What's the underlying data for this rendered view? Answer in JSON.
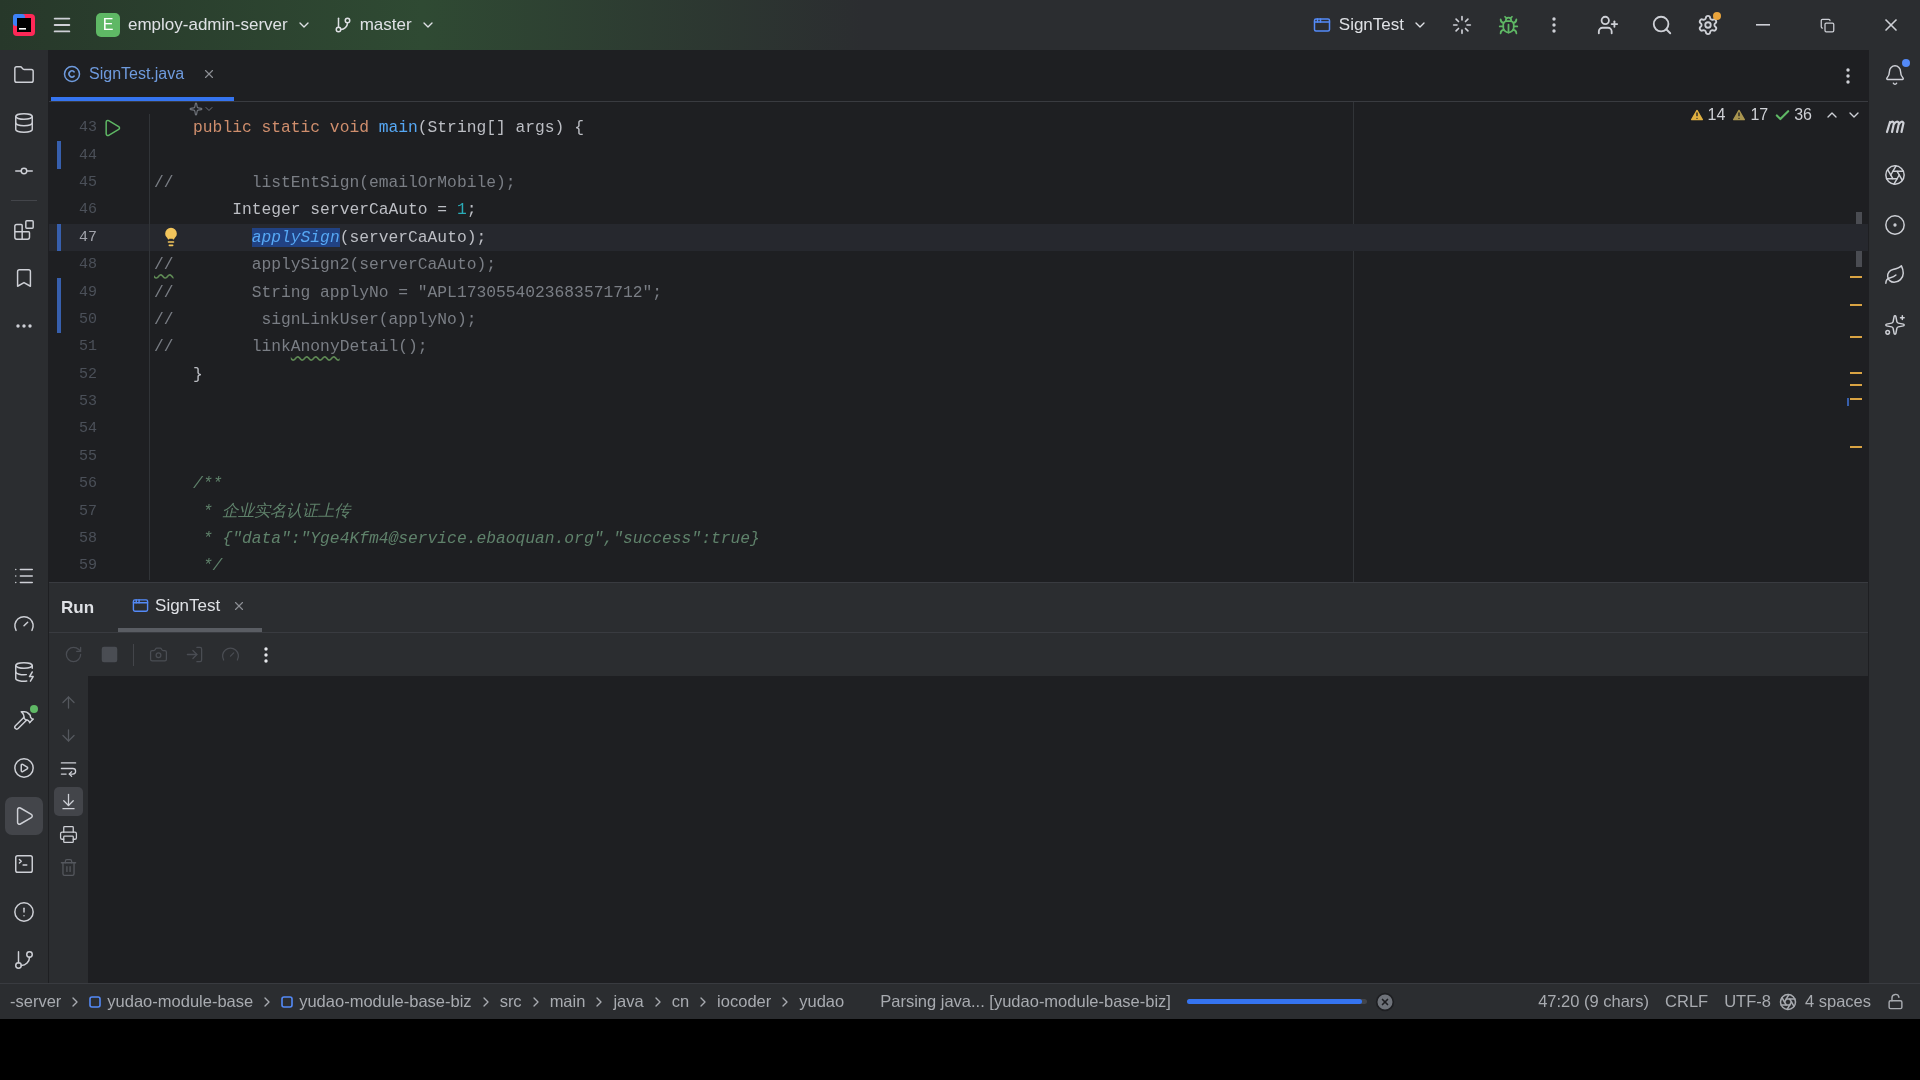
{
  "title_bar": {
    "project_badge": "E",
    "project": "employ-admin-server",
    "branch": "master",
    "run_config": "SignTest"
  },
  "left_tools_top": [
    {
      "kind": "project",
      "selected": false
    },
    {
      "kind": "database",
      "selected": false
    },
    {
      "kind": "commit",
      "selected": false
    },
    {
      "kind": "structure",
      "selected": false
    },
    {
      "kind": "bookmarks",
      "selected": false
    },
    {
      "kind": "more",
      "selected": false
    }
  ],
  "left_tools_bottom": [
    {
      "kind": "outline",
      "selected": false
    },
    {
      "kind": "profiler",
      "selected": false
    },
    {
      "kind": "db-check",
      "selected": false
    },
    {
      "kind": "build",
      "selected": false
    },
    {
      "kind": "services",
      "selected": false
    },
    {
      "kind": "run",
      "selected": true
    },
    {
      "kind": "terminal",
      "selected": false
    },
    {
      "kind": "problems",
      "selected": false
    },
    {
      "kind": "git",
      "selected": false
    }
  ],
  "right_tools": [
    {
      "kind": "notifications"
    },
    {
      "kind": "script"
    },
    {
      "kind": "aperture"
    },
    {
      "kind": "target"
    },
    {
      "kind": "leaf"
    },
    {
      "kind": "assistant"
    }
  ],
  "editor": {
    "tabs": [
      {
        "label": "SignTest.java",
        "selected": true
      }
    ],
    "inspections": [
      {
        "kind": "warning",
        "count": "14"
      },
      {
        "kind": "weak-warning",
        "count": "17"
      },
      {
        "kind": "ok",
        "count": "36"
      }
    ],
    "lines": [
      {
        "number": "43",
        "gutter": {
          "kind": "run"
        },
        "changed": false,
        "current": false,
        "tokens": [
          {
            "text": "    public static void ",
            "kind": "keyword"
          },
          {
            "text": "main",
            "kind": "method"
          },
          {
            "text": "(String[] args) {",
            "kind": "plain"
          }
        ]
      },
      {
        "number": "44",
        "changed": true,
        "current": false
      },
      {
        "number": "45",
        "changed": false,
        "current": false,
        "tokens": [
          {
            "text": "//        listEntSign(emailOrMobile);",
            "kind": "comment"
          }
        ]
      },
      {
        "number": "46",
        "changed": false,
        "current": false,
        "tokens": [
          {
            "text": "        Integer serverCaAuto = ",
            "kind": "plain"
          },
          {
            "text": "1",
            "kind": "number"
          },
          {
            "text": ";",
            "kind": "plain"
          }
        ]
      },
      {
        "number": "47",
        "gutter": {
          "kind": "bulb"
        },
        "changed": true,
        "current": true,
        "tokens": [
          {
            "text": "          applySign",
            "kind": "selected-method"
          },
          {
            "text": "(serverCaAuto);",
            "kind": "plain"
          }
        ]
      },
      {
        "number": "48",
        "changed": false,
        "current": false,
        "tokens": [
          {
            "text": "//",
            "kind": "comment-typo"
          },
          {
            "text": "        applySign2(serverCaAuto);",
            "kind": "comment"
          }
        ]
      },
      {
        "number": "49",
        "changed": true,
        "current": false,
        "tokens": [
          {
            "text": "//        String applyNo = \"APL1730554023683571712\";",
            "kind": "comment"
          }
        ]
      },
      {
        "number": "50",
        "changed": true,
        "current": false,
        "tokens": [
          {
            "text": "//         signLinkUser(applyNo);",
            "kind": "comment"
          }
        ]
      },
      {
        "number": "51",
        "changed": false,
        "current": false,
        "tokens": [
          {
            "text": "//        link",
            "kind": "comment"
          },
          {
            "text": "Anony",
            "kind": "comment-typo"
          },
          {
            "text": "Detail();",
            "kind": "comment"
          }
        ]
      },
      {
        "number": "52",
        "changed": false,
        "current": false,
        "tokens": [
          {
            "text": "    }",
            "kind": "plain"
          }
        ]
      },
      {
        "number": "53",
        "changed": false,
        "current": false
      },
      {
        "number": "54",
        "changed": false,
        "current": false
      },
      {
        "number": "55",
        "changed": false,
        "current": false
      },
      {
        "number": "56",
        "changed": false,
        "current": false,
        "tokens": [
          {
            "text": "    /**",
            "kind": "doc"
          }
        ]
      },
      {
        "number": "57",
        "changed": false,
        "current": false,
        "tokens": [
          {
            "text": "     * 企业实名认证上传",
            "kind": "doc"
          }
        ]
      },
      {
        "number": "58",
        "changed": false,
        "current": false,
        "tokens": [
          {
            "text": "     * {\"data\":\"Yge4Kfm4@service.ebaoquan.org\",\"success\":true}",
            "kind": "doc"
          }
        ]
      },
      {
        "number": "59",
        "changed": false,
        "current": false,
        "tokens": [
          {
            "text": "     */",
            "kind": "doc"
          }
        ]
      }
    ]
  },
  "run_panel": {
    "title": "Run",
    "tabs": [
      {
        "label": "SignTest",
        "selected": true
      }
    ],
    "toolbar": [
      {
        "kind": "rerun"
      },
      {
        "kind": "stop"
      },
      {
        "kind": "dump"
      },
      {
        "kind": "exit"
      },
      {
        "kind": "profile"
      },
      {
        "kind": "more"
      }
    ],
    "side_tools": [
      {
        "kind": "up",
        "disabled": true,
        "selected": false
      },
      {
        "kind": "down",
        "disabled": true,
        "selected": false
      },
      {
        "kind": "wrap",
        "disabled": false,
        "selected": false
      },
      {
        "kind": "scroll-end",
        "disabled": false,
        "selected": true
      },
      {
        "kind": "print",
        "disabled": false,
        "selected": false
      },
      {
        "kind": "clear",
        "disabled": true,
        "selected": false
      }
    ]
  },
  "status_bar": {
    "breadcrumbs": [
      {
        "label": "-server",
        "kind": "folder"
      },
      {
        "label": "yudao-module-base",
        "kind": "module"
      },
      {
        "label": "yudao-module-base-biz",
        "kind": "module"
      },
      {
        "label": "src",
        "kind": "folder"
      },
      {
        "label": "main",
        "kind": "folder"
      },
      {
        "label": "java",
        "kind": "folder"
      },
      {
        "label": "cn",
        "kind": "folder"
      },
      {
        "label": "iocoder",
        "kind": "folder"
      },
      {
        "label": "yudao",
        "kind": "folder"
      }
    ],
    "task": "Parsing java... [yudao-module-base-biz]",
    "progress": {
      "level": 0.97
    },
    "position": "47:20 (9 chars)",
    "line_separator": "CRLF",
    "encoding": "UTF-8",
    "indent": "4 spaces"
  }
}
